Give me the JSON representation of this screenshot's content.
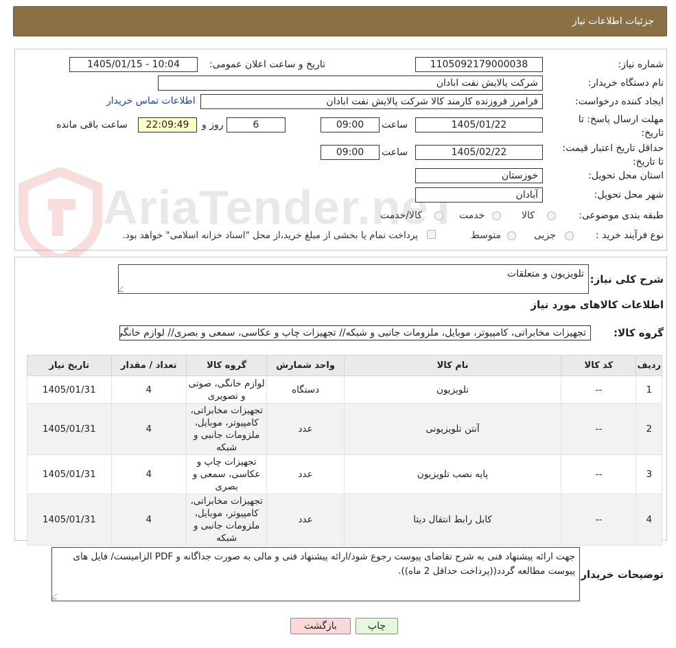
{
  "header": {
    "title": "جزئیات اطلاعات نیاز"
  },
  "form": {
    "need_number_label": "شماره نیاز:",
    "need_number": "1105092179000038",
    "announce_label": "تاریخ و ساعت اعلان عمومی:",
    "announce_value": "1405/01/15 - 10:04",
    "buyer_org_label": "نام دستگاه خریدار:",
    "buyer_org": "شرکت پالایش نفت ابادان",
    "requester_label": "ایجاد کننده درخواست:",
    "requester": "فرامرز فروزنده کارمند کالا شرکت پالایش نفت ابادان",
    "contact_link": "اطلاعات تماس خریدار",
    "deadline_label": "مهلت ارسال پاسخ: تا تاریخ:",
    "deadline_date": "1405/01/22",
    "time_label": "ساعت",
    "deadline_time": "09:00",
    "days_value": "6",
    "days_label": "روز و",
    "remaining_time": "22:09:49",
    "remaining_label": "ساعت باقی مانده",
    "validity_label": "حداقل تاریخ اعتبار قیمت: تا تاریخ:",
    "validity_date": "1405/02/22",
    "validity_time": "09:00",
    "province_label": "استان محل تحویل:",
    "province": "خوزستان",
    "city_label": "شهر محل تحویل:",
    "city": "آبادان",
    "category_label": "طبقه بندی موضوعی:",
    "category_options": [
      "کالا",
      "خدمت",
      "کالا/خدمت"
    ],
    "purchase_type_label": "نوع فرآیند خرید :",
    "purchase_options": [
      "جزیی",
      "متوسط"
    ],
    "payment_note": "پرداخت تمام یا بخشی از مبلغ خرید،از محل \"اسناد خزانه اسلامی\" خواهد بود."
  },
  "summary": {
    "description_label": "شرح کلی نیاز:",
    "description": "تلویزیون و متعلقات",
    "items_heading": "اطلاعات کالاهای مورد نیاز",
    "group_label": "گروه کالا:",
    "group_value": "تجهیزات مخابراتی، کامپیوتر، موبایل، ملزومات جانبی و شبکه// تجهیزات چاپ و عکاسی، سمعی و بصری// لوازم خانگی، صوتی و تصویری"
  },
  "table": {
    "headers": [
      "ردیف",
      "کد کالا",
      "نام کالا",
      "واحد شمارش",
      "گروه کالا",
      "تعداد / مقدار",
      "تاریخ نیاز"
    ],
    "rows": [
      {
        "row": "1",
        "code": "--",
        "name": "تلویزیون",
        "unit": "دستگاه",
        "group": "لوازم خانگی، صوتی و تصویری",
        "qty": "4",
        "date": "1405/01/31"
      },
      {
        "row": "2",
        "code": "--",
        "name": "آنتن تلویزیونی",
        "unit": "عدد",
        "group": "تجهیزات مخابراتی، کامپیوتر، موبایل، ملزومات جانبی و شبکه",
        "qty": "4",
        "date": "1405/01/31"
      },
      {
        "row": "3",
        "code": "--",
        "name": "پایه نصب تلویزیون",
        "unit": "عدد",
        "group": "تجهیزات چاپ و عکاسی، سمعی و بصری",
        "qty": "4",
        "date": "1405/01/31"
      },
      {
        "row": "4",
        "code": "--",
        "name": "کابل رابط انتقال دیتا",
        "unit": "عدد",
        "group": "تجهیزات مخابراتی، کامپیوتر، موبایل، ملزومات جانبی و شبکه",
        "qty": "4",
        "date": "1405/01/31"
      }
    ]
  },
  "buyer_notes": {
    "label": "توضیحات خریدار:",
    "text": "جهت ارائه پیشنهاد فنی به شرح تقاضای پیوست رجوع شود/ارائه پیشنهاد فنی و مالی به صورت جداگانه و PDF الزامیست/ فایل های پیوست مطالعه گردد((پرداخت حداقل 2 ماه))."
  },
  "buttons": {
    "print": "چاپ",
    "back": "بازگشت"
  },
  "watermark": {
    "text": "AriaTender.neT"
  },
  "colors": {
    "header_bg": "#8b6f45",
    "link": "#1f3fb8",
    "back_button": "#fbd9d9",
    "print_button": "#e6f8dc",
    "remaining_bg": "#ffffc8"
  }
}
